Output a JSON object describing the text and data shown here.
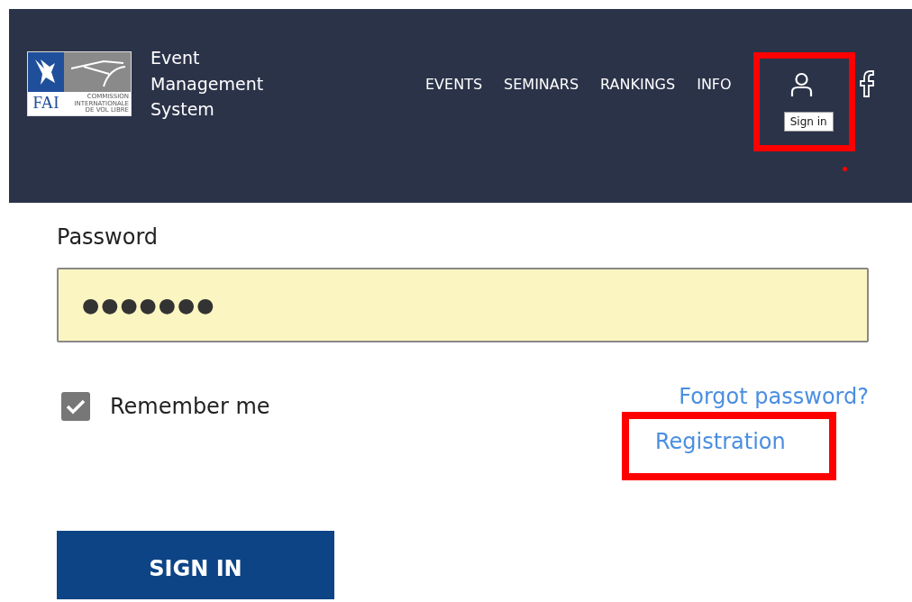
{
  "header": {
    "logo": {
      "letters": "FAI",
      "caption": [
        "COMMISSION",
        "INTERNATIONALE",
        "DE VOL LIBRE"
      ]
    },
    "title": [
      "Event",
      "Management",
      "System"
    ],
    "nav": [
      {
        "label": "EVENTS"
      },
      {
        "label": "SEMINARS"
      },
      {
        "label": "RANKINGS"
      },
      {
        "label": "INFO"
      }
    ],
    "account": {
      "tooltip": "Sign in",
      "highlighted": true
    },
    "annotation_dot": true
  },
  "form": {
    "password": {
      "label": "Password",
      "value": "●●●●●●●"
    },
    "remember": {
      "label": "Remember me",
      "checked": true
    },
    "links": [
      {
        "label": "Forgot password?",
        "highlighted": false
      },
      {
        "label": "Registration",
        "highlighted": true
      }
    ],
    "submit": "SIGN IN"
  }
}
